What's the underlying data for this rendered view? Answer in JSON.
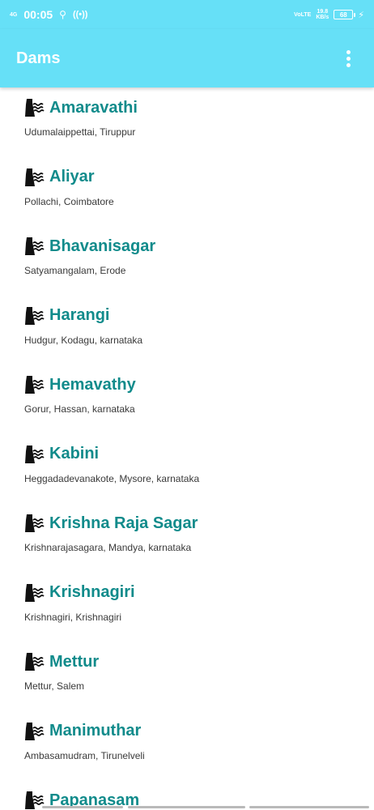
{
  "status_bar": {
    "network": "4G",
    "time": "00:05",
    "lte": "VoLTE",
    "speed_value": "19.8",
    "speed_unit": "KB/s",
    "battery": "68"
  },
  "app_bar": {
    "title": "Dams",
    "menu_icon": "more-vert-icon"
  },
  "dams": [
    {
      "name": "Amaravathi",
      "location": "Udumalaippettai, Tiruppur"
    },
    {
      "name": "Aliyar",
      "location": "Pollachi, Coimbatore"
    },
    {
      "name": "Bhavanisagar",
      "location": "Satyamangalam, Erode"
    },
    {
      "name": "Harangi",
      "location": "Hudgur, Kodagu, karnataka"
    },
    {
      "name": "Hemavathy",
      "location": "Gorur, Hassan, karnataka"
    },
    {
      "name": "Kabini",
      "location": "Heggadadevanakote, Mysore, karnataka"
    },
    {
      "name": "Krishna Raja Sagar",
      "location": "Krishnarajasagara, Mandya, karnataka"
    },
    {
      "name": "Krishnagiri",
      "location": "Krishnagiri, Krishnagiri"
    },
    {
      "name": "Mettur",
      "location": "Mettur, Salem"
    },
    {
      "name": "Manimuthar",
      "location": "Ambasamudram, Tirunelveli"
    },
    {
      "name": "Papanasam",
      "location": ""
    }
  ],
  "colors": {
    "app_bar": "#66e0f7",
    "dam_name": "#118b8b",
    "location_text": "#3a3a3a"
  }
}
